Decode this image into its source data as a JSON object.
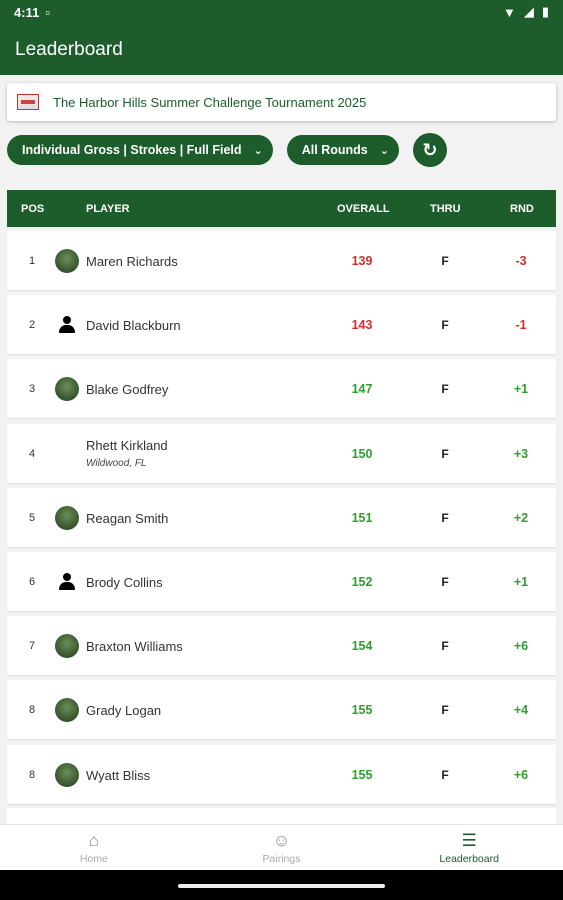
{
  "status_bar": {
    "time": "4:11"
  },
  "app_bar": {
    "title": "Leaderboard"
  },
  "tournament": {
    "name": "The Harbor Hills Summer Challenge Tournament 2025"
  },
  "filters": {
    "scoring": "Individual Gross | Strokes | Full Field",
    "rounds": "All Rounds"
  },
  "table": {
    "headers": {
      "pos": "POS",
      "player": "PLAYER",
      "overall": "OVERALL",
      "thru": "THRU",
      "rnd": "RND"
    },
    "rows": [
      {
        "pos": "1",
        "player": "Maren Richards",
        "location": "",
        "overall": "139",
        "thru": "F",
        "rnd": "-3",
        "avatar": "photo"
      },
      {
        "pos": "2",
        "player": "David Blackburn",
        "location": "",
        "overall": "143",
        "thru": "F",
        "rnd": "-1",
        "avatar": "person-icon"
      },
      {
        "pos": "3",
        "player": "Blake Godfrey",
        "location": "",
        "overall": "147",
        "thru": "F",
        "rnd": "+1",
        "avatar": "photo"
      },
      {
        "pos": "4",
        "player": "Rhett Kirkland",
        "location": "Wildwood, FL",
        "overall": "150",
        "thru": "F",
        "rnd": "+3",
        "avatar": "none"
      },
      {
        "pos": "5",
        "player": "Reagan Smith",
        "location": "",
        "overall": "151",
        "thru": "F",
        "rnd": "+2",
        "avatar": "photo"
      },
      {
        "pos": "6",
        "player": "Brody Collins",
        "location": "",
        "overall": "152",
        "thru": "F",
        "rnd": "+1",
        "avatar": "person-icon"
      },
      {
        "pos": "7",
        "player": "Braxton Williams",
        "location": "",
        "overall": "154",
        "thru": "F",
        "rnd": "+6",
        "avatar": "photo"
      },
      {
        "pos": "8",
        "player": "Grady Logan",
        "location": "",
        "overall": "155",
        "thru": "F",
        "rnd": "+4",
        "avatar": "photo"
      },
      {
        "pos": "8",
        "player": "Wyatt Bliss",
        "location": "",
        "overall": "155",
        "thru": "F",
        "rnd": "+6",
        "avatar": "photo"
      }
    ]
  },
  "bottom_nav": {
    "items": [
      {
        "label": "Home",
        "icon": "home-icon",
        "active": false
      },
      {
        "label": "Pairings",
        "icon": "people-icon",
        "active": false
      },
      {
        "label": "Leaderboard",
        "icon": "list-icon",
        "active": true
      }
    ]
  },
  "colors": {
    "primary": "#1c5d2b",
    "under_par": "#d32f2f",
    "over_par": "#2e9e2e"
  }
}
